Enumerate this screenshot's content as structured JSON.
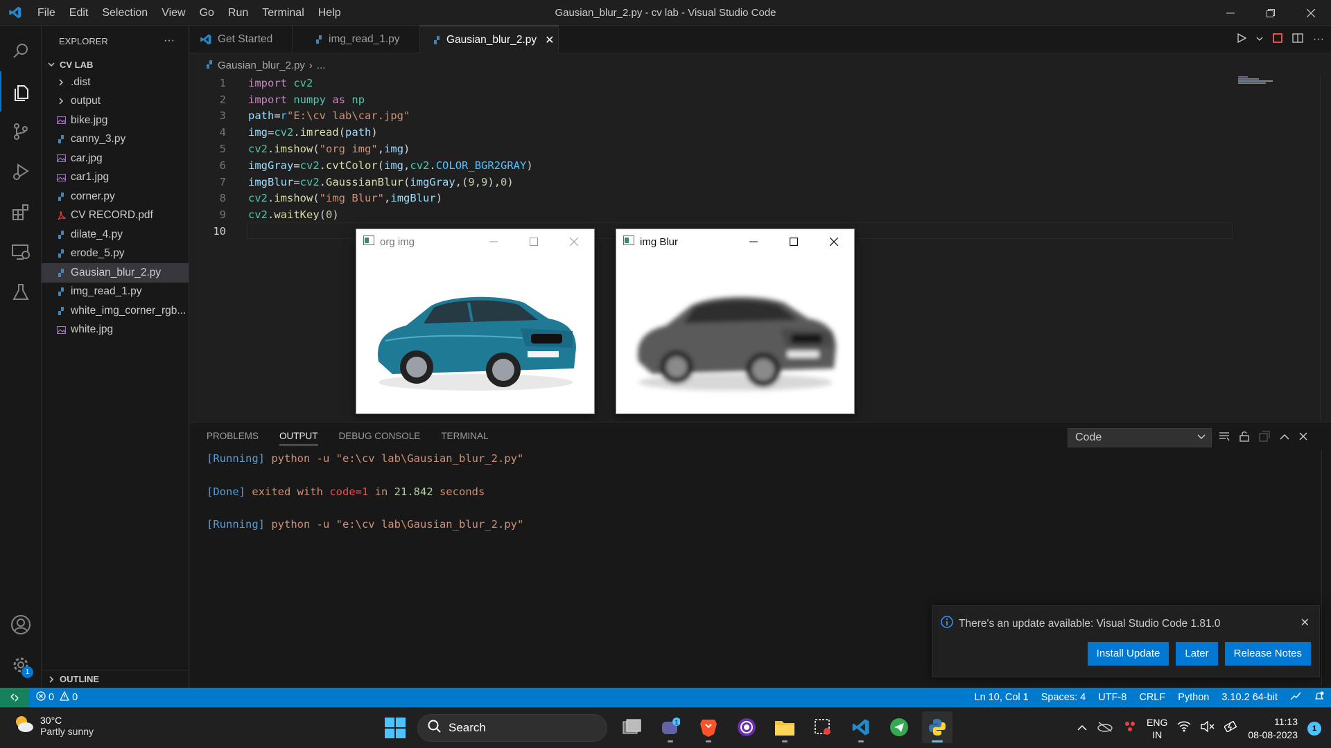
{
  "titlebar": {
    "menu": [
      "File",
      "Edit",
      "Selection",
      "View",
      "Go",
      "Run",
      "Terminal",
      "Help"
    ],
    "title": "Gausian_blur_2.py - cv lab - Visual Studio Code"
  },
  "activitybar": {
    "icons": [
      "search-icon",
      "explorer-icon",
      "source-control-icon",
      "run-debug-icon",
      "extensions-icon",
      "remote-explorer-icon",
      "testing-icon",
      "account-icon",
      "settings-gear-icon"
    ],
    "settings_badge": "1"
  },
  "sidebar": {
    "header": "EXPLORER",
    "more": "···",
    "folder": "CV LAB",
    "items": [
      {
        "label": ".dist",
        "kind": "folder"
      },
      {
        "label": "output",
        "kind": "folder"
      },
      {
        "label": "bike.jpg",
        "kind": "image"
      },
      {
        "label": "canny_3.py",
        "kind": "python"
      },
      {
        "label": "car.jpg",
        "kind": "image"
      },
      {
        "label": "car1.jpg",
        "kind": "image"
      },
      {
        "label": "corner.py",
        "kind": "python"
      },
      {
        "label": "CV RECORD.pdf",
        "kind": "pdf"
      },
      {
        "label": "dilate_4.py",
        "kind": "python"
      },
      {
        "label": "erode_5.py",
        "kind": "python"
      },
      {
        "label": "Gausian_blur_2.py",
        "kind": "python",
        "selected": true
      },
      {
        "label": "img_read_1.py",
        "kind": "python"
      },
      {
        "label": "white_img_corner_rgb...",
        "kind": "python"
      },
      {
        "label": "white.jpg",
        "kind": "image"
      }
    ],
    "outline": "OUTLINE"
  },
  "tabs": [
    {
      "label": "Get Started",
      "icon": "vscode-icon"
    },
    {
      "label": "img_read_1.py",
      "icon": "python-icon"
    },
    {
      "label": "Gausian_blur_2.py",
      "icon": "python-icon",
      "active": true
    }
  ],
  "breadcrumb": {
    "file": "Gausian_blur_2.py",
    "sep": "›",
    "rest": "..."
  },
  "code": {
    "line_numbers": [
      "1",
      "2",
      "3",
      "4",
      "5",
      "6",
      "7",
      "8",
      "9",
      "10"
    ],
    "current_line": "10"
  },
  "cv_windows": [
    {
      "title": "org img",
      "image": "color-car"
    },
    {
      "title": "img Blur",
      "image": "blurred-gray-car"
    }
  ],
  "panel": {
    "tabs": [
      "PROBLEMS",
      "OUTPUT",
      "DEBUG CONSOLE",
      "TERMINAL"
    ],
    "active_tab": "OUTPUT",
    "channel": "Code",
    "output": [
      {
        "tag": "[Running]",
        "text": " python -u \"e:\\cv lab\\Gausian_blur_2.py\""
      },
      {
        "tag": "",
        "text": ""
      },
      {
        "tag": "[Done]",
        "pre": " exited with ",
        "code": "code=1",
        "mid": " in ",
        "num": "21.842",
        "post": " seconds"
      },
      {
        "tag": "",
        "text": ""
      },
      {
        "tag": "[Running]",
        "text": " python -u \"e:\\cv lab\\Gausian_blur_2.py\""
      }
    ]
  },
  "notification": {
    "message": "There's an update available: Visual Studio Code 1.81.0",
    "buttons": [
      "Install Update",
      "Later",
      "Release Notes"
    ]
  },
  "statusbar": {
    "errors": "0",
    "warnings": "0",
    "position": "Ln 10, Col 1",
    "spaces": "Spaces: 4",
    "encoding": "UTF-8",
    "eol": "CRLF",
    "language": "Python",
    "interpreter": "3.10.2 64-bit"
  },
  "taskbar": {
    "weather_temp": "30°C",
    "weather_desc": "Partly sunny",
    "search": "Search",
    "apps": [
      "task-view-icon",
      "teams-chat-icon",
      "brave-browser-icon",
      "podcast-app-icon",
      "file-explorer-icon",
      "snipping-tool-icon",
      "vscode-icon",
      "telegram-icon",
      "python-icon"
    ],
    "chat_badge": "1",
    "lang_top": "ENG",
    "lang_bottom": "IN",
    "time": "11:13",
    "date": "08-08-2023",
    "notif_count": "1"
  },
  "colors": {
    "accent": "#0078d4",
    "statusbar": "#007acc",
    "editor_bg": "#1f1f1f"
  }
}
